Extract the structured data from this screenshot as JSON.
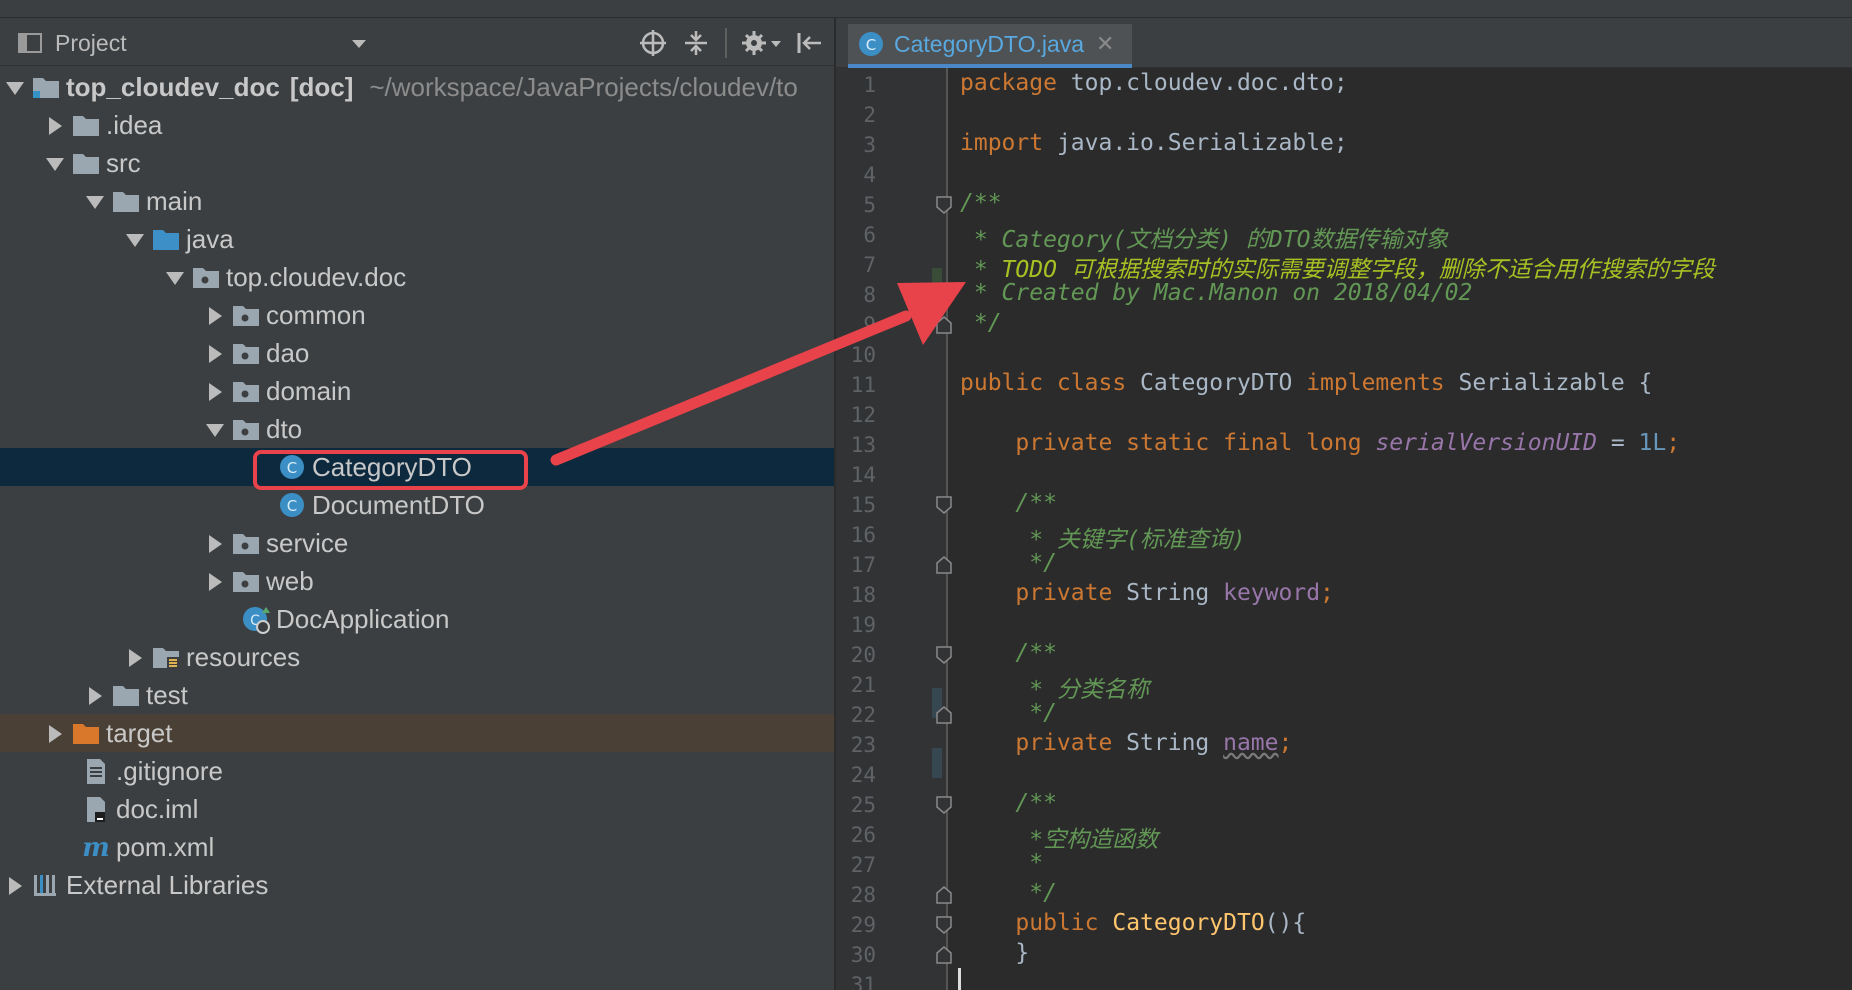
{
  "project_pane": {
    "title": "Project",
    "tree": [
      {
        "label": "top_cloudev_doc",
        "tag": "[doc]",
        "path": "~/workspace/JavaProjects/cloudev/to"
      },
      {
        "label": ".idea"
      },
      {
        "label": "src"
      },
      {
        "label": "main"
      },
      {
        "label": "java"
      },
      {
        "label": "top.cloudev.doc"
      },
      {
        "label": "common"
      },
      {
        "label": "dao"
      },
      {
        "label": "domain"
      },
      {
        "label": "dto"
      },
      {
        "label": "CategoryDTO"
      },
      {
        "label": "DocumentDTO"
      },
      {
        "label": "service"
      },
      {
        "label": "web"
      },
      {
        "label": "DocApplication"
      },
      {
        "label": "resources"
      },
      {
        "label": "test"
      },
      {
        "label": "target"
      },
      {
        "label": ".gitignore"
      },
      {
        "label": "doc.iml"
      },
      {
        "label": "pom.xml"
      },
      {
        "label": "External Libraries"
      }
    ]
  },
  "editor": {
    "tab_label": "CategoryDTO.java",
    "tab_close": "✕",
    "tab_badge": "C",
    "line_numbers": [
      "1",
      "2",
      "3",
      "4",
      "5",
      "6",
      "7",
      "8",
      "9",
      "10",
      "11",
      "12",
      "13",
      "14",
      "15",
      "16",
      "17",
      "18",
      "19",
      "20",
      "21",
      "22",
      "23",
      "24",
      "25",
      "26",
      "27",
      "28",
      "29",
      "30",
      "31"
    ],
    "code": {
      "l1_kw": "package",
      "l1_rest": " top.cloudev.doc.dto;",
      "l3_kw": "import",
      "l3_rest": " java.io.Serializable;",
      "l5": "/**",
      "l6_a": " * Category(",
      "l6_b": "文档分类",
      "l6_c": ") ",
      "l6_d": "的",
      "l6_e": "DTO",
      "l6_f": "数据传输对象",
      "l7_a": " * ",
      "l7_b": "TODO",
      "l7_c": " 可根据搜索时的实际需要调整字段，删除不适合用作搜索的字段",
      "l8": " * Created by Mac.Manon on 2018/04/02",
      "l9": " */",
      "l11_a": "public class",
      "l11_b": " CategoryDTO ",
      "l11_c": "implements",
      "l11_d": " Serializable {",
      "l13_a": "    private static final long",
      "l13_b": "serialVersionUID",
      "l13_c": " = ",
      "l13_d": "1L",
      "l13_e": ";",
      "l15": "    /**",
      "l16_a": "     * ",
      "l16_b": "关键字",
      "l16_c": "(",
      "l16_d": "标准查询",
      "l16_e": ")",
      "l17": "     */",
      "l18_a": "    private",
      "l18_b": " String ",
      "l18_c": "keyword",
      "l18_d": ";",
      "l20": "    /**",
      "l21_a": "     * ",
      "l21_b": "分类名称",
      "l22": "     */",
      "l23_a": "    private",
      "l23_b": " String ",
      "l23_c": "name",
      "l23_d": ";",
      "l25": "    /**",
      "l26_a": "     *",
      "l26_b": "空构造函数",
      "l27": "     *",
      "l28": "     */",
      "l29_a": "    public",
      "l29_b": "CategoryDTO",
      "l29_c": "(){",
      "l30": "    }"
    }
  },
  "colors": {
    "accent": "#4a88c7",
    "annotation_red": "#e8434b",
    "keyword": "#cc7832",
    "comment": "#629755",
    "todo": "#a8c023"
  }
}
